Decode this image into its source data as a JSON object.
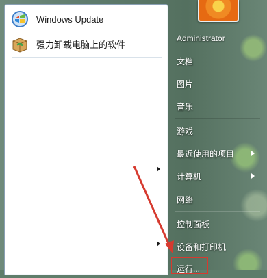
{
  "start_menu": {
    "pinned": [
      {
        "label": "Windows Update",
        "icon": "windows-update-icon"
      },
      {
        "label": "强力卸载电脑上的软件",
        "icon": "uninstall-box-icon"
      }
    ],
    "user_name": "Administrator",
    "right_items": [
      {
        "label": "文档"
      },
      {
        "label": "图片"
      },
      {
        "label": "音乐"
      },
      {
        "label": "游戏"
      },
      {
        "label": "最近使用的项目"
      },
      {
        "label": "计算机"
      },
      {
        "label": "网络"
      },
      {
        "label": "控制面板"
      },
      {
        "label": "设备和打印机"
      },
      {
        "label": "运行..."
      }
    ]
  },
  "annotation": {
    "color": "#d63a2f"
  }
}
